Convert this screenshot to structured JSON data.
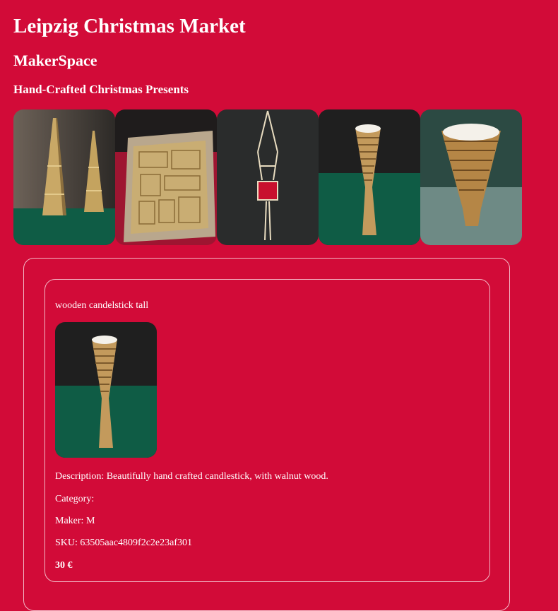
{
  "header": {
    "title": "Leipzig Christmas Market",
    "subtitle": "MakerSpace",
    "section": "Hand-Crafted Christmas Presents"
  },
  "gallery": [
    {
      "subject": "wooden eiffel towers"
    },
    {
      "subject": "laser-cut wooden kit"
    },
    {
      "subject": "macrame plant hanger"
    },
    {
      "subject": "wooden candlestick tall"
    },
    {
      "subject": "wooden tea-light holder"
    }
  ],
  "product": {
    "name": "wooden candelstick tall",
    "description_label": "Description:",
    "description": "Beautifully hand crafted candlestick, with walnut wood.",
    "category_label": "Category:",
    "category": "",
    "maker_label": "Maker:",
    "maker": "M",
    "sku_label": "SKU:",
    "sku": "63505aac4809f2c2e23af301",
    "price": "30 €"
  },
  "colors": {
    "background": "#d20b38",
    "text": "#ffffff",
    "card_border": "#f3b9c6"
  }
}
